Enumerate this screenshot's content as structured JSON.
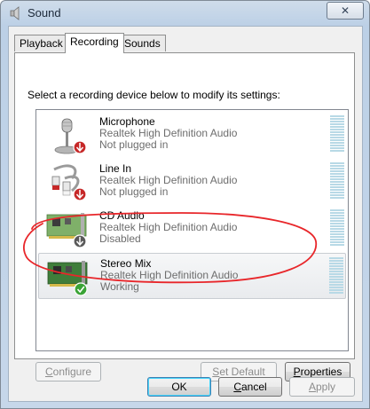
{
  "window": {
    "title": "Sound",
    "close_label": "✕"
  },
  "tabs": [
    {
      "label": "Playback",
      "active": false
    },
    {
      "label": "Recording",
      "active": true
    },
    {
      "label": "Sounds",
      "active": false
    }
  ],
  "instruction": "Select a recording device below to modify its settings:",
  "devices": [
    {
      "name": "Microphone",
      "driver": "Realtek High Definition Audio",
      "status": "Not plugged in",
      "icon": "microphone-icon",
      "badge": "red-down-arrow"
    },
    {
      "name": "Line In",
      "driver": "Realtek High Definition Audio",
      "status": "Not plugged in",
      "icon": "line-in-cable-icon",
      "badge": "red-down-arrow"
    },
    {
      "name": "CD Audio",
      "driver": "Realtek High Definition Audio",
      "status": "Disabled",
      "icon": "sound-card-icon",
      "badge": "grey-down-arrow"
    },
    {
      "name": "Stereo Mix",
      "driver": "Realtek High Definition Audio",
      "status": "Working",
      "icon": "sound-card-icon",
      "badge": "green-check",
      "selected": true
    }
  ],
  "buttons": {
    "configure": "Configure",
    "set_default": "Set Default",
    "properties": "Properties",
    "ok": "OK",
    "cancel": "Cancel",
    "apply": "Apply"
  },
  "colors": {
    "annotation": "#e8262a",
    "meter": "#b8d9e6",
    "status_text": "#6d6d6d"
  }
}
